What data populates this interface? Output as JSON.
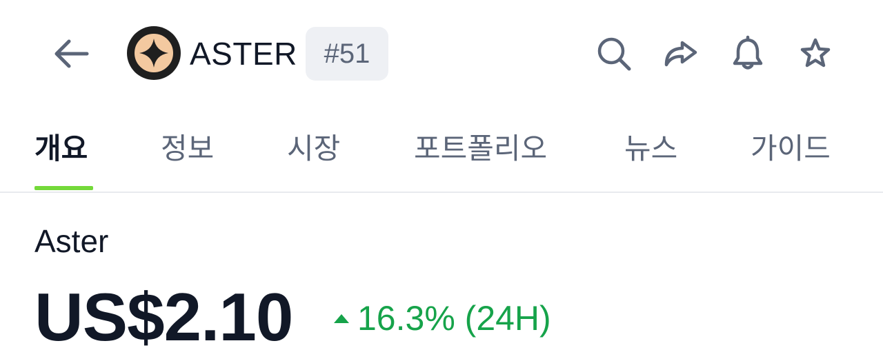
{
  "header": {
    "symbol": "ASTER",
    "rank": "#51",
    "icons": [
      "back-arrow-icon",
      "search-icon",
      "share-icon",
      "bell-icon",
      "star-icon"
    ]
  },
  "tabs": [
    {
      "label": "개요",
      "active": true
    },
    {
      "label": "정보",
      "active": false
    },
    {
      "label": "시장",
      "active": false
    },
    {
      "label": "포트폴리오",
      "active": false
    },
    {
      "label": "뉴스",
      "active": false
    },
    {
      "label": "가이드",
      "active": false
    }
  ],
  "coin": {
    "name": "Aster",
    "price": "US$2.10",
    "change": "16.3% (24H)",
    "change_direction": "up"
  },
  "colors": {
    "accent": "#74d93a",
    "positive": "#16a34a",
    "icon": "#5b6578",
    "text": "#111827",
    "badge_bg": "#eef0f4",
    "logo_dark": "#1f1f1f",
    "logo_fill": "#f3c9a0"
  }
}
